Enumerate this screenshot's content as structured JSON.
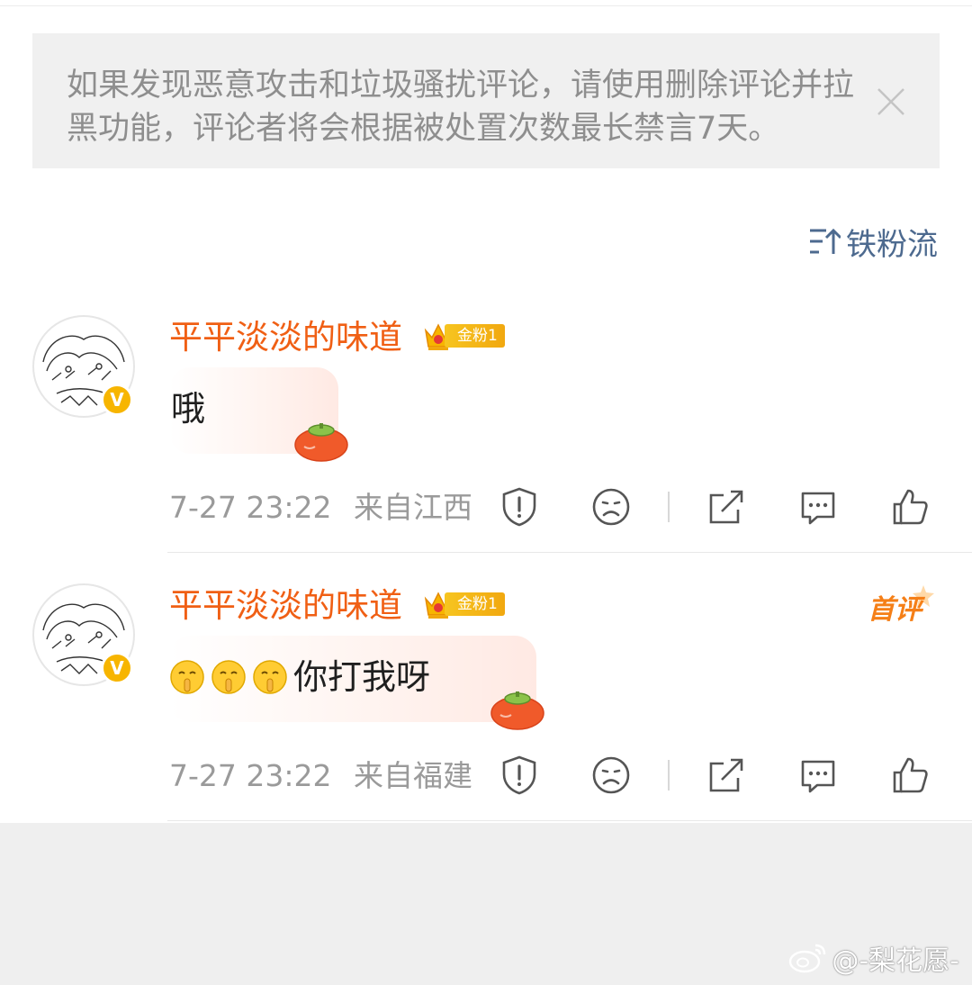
{
  "notice": {
    "text": "如果发现恶意攻击和垃圾骚扰评论，请使用删除评论并拉黑功能，评论者将会根据被处置次数最长禁言7天。"
  },
  "sort": {
    "label": "铁粉流"
  },
  "comments": [
    {
      "username": "平平淡淡的味道",
      "fan_badge": "金粉1",
      "text": "哦",
      "time": "7-27 23:22",
      "location": "来自江西"
    },
    {
      "username": "平平淡淡的味道",
      "fan_badge": "金粉1",
      "first_badge": "首评",
      "text": "你打我呀",
      "time": "7-27 23:22",
      "location": "来自福建"
    }
  ],
  "watermark": {
    "text": "@-梨花愿-"
  },
  "colors": {
    "username": "#f05f14",
    "sort": "#4d6a8f",
    "badge": "#f1a80f",
    "verified": "#f7b500"
  },
  "icons": [
    "close-icon",
    "sort-icon",
    "report-icon",
    "dislike-icon",
    "share-icon",
    "reply-icon",
    "like-icon",
    "weibo-icon"
  ]
}
